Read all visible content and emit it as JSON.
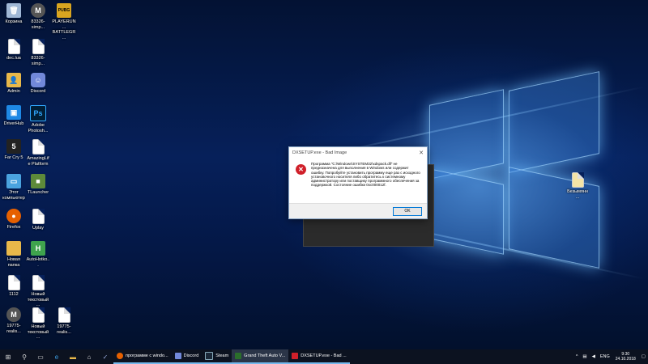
{
  "desktop": {
    "icons": [
      {
        "label": "Корзина",
        "icon": "recycle-bin-icon",
        "color": "#9fb7d6"
      },
      {
        "label": "83326-simp...",
        "icon": "app-m-icon",
        "color": "#555555"
      },
      {
        "label": "PLAYERUN... BATTLEGR...",
        "icon": "pubg-icon",
        "color": "#d9a520"
      },
      {
        "label": "dec.lua",
        "icon": "file-icon",
        "color": "#ffffff"
      },
      {
        "label": "83326-simp...",
        "icon": "file-icon",
        "color": "#ffffff"
      },
      {
        "label": "Admin",
        "icon": "user-folder-icon",
        "color": "#e8b84a"
      },
      {
        "label": "Discord",
        "icon": "discord-icon",
        "color": "#7289da"
      },
      {
        "label": "DriverHub",
        "icon": "driverhub-icon",
        "color": "#1e88e5"
      },
      {
        "label": "Adobe Photosh...",
        "icon": "photoshop-icon",
        "color": "#001e36"
      },
      {
        "label": "Far Cry 5",
        "icon": "farcry5-icon",
        "color": "#222222"
      },
      {
        "label": "AmazingLife Platform",
        "icon": "file-icon",
        "color": "#ffffff"
      },
      {
        "label": "Этот компьютер",
        "icon": "computer-icon",
        "color": "#4aa3df"
      },
      {
        "label": "TLauncher",
        "icon": "minecraft-icon",
        "color": "#5d8a3a"
      },
      {
        "label": "Firefox",
        "icon": "firefox-icon",
        "color": "#e66000"
      },
      {
        "label": "Uplay",
        "icon": "file-icon",
        "color": "#ffffff"
      },
      {
        "label": "Новая папка",
        "icon": "folder-icon",
        "color": "#e8b84a"
      },
      {
        "label": "AutoHotko...",
        "icon": "autohotkey-icon",
        "color": "#3fa34d"
      },
      {
        "label": "1112",
        "icon": "file-icon",
        "color": "#ffffff"
      },
      {
        "label": "Новый текстовый ...",
        "icon": "file-icon",
        "color": "#ffffff"
      },
      {
        "label": "19775-realis...",
        "icon": "app-m-icon",
        "color": "#555555"
      },
      {
        "label": "Новый текстовый ...",
        "icon": "file-icon",
        "color": "#ffffff"
      },
      {
        "label": "19775-realis...",
        "icon": "file-icon",
        "color": "#ffffff"
      }
    ],
    "right_file": {
      "label": "Безымянн..."
    }
  },
  "dialog": {
    "title": "DXSETUP.exe - Bad Image",
    "close": "✕",
    "message": "Программа \"C:\\Windows\\SYSTEM32\\xdspack.dll\" не предназначена для выполнения в Windows или содержит ошибку. Попробуйте установить программу еще раз с исходного установочного носителя либо обратитесь к системному администратору или поставщику программного обеспечения за поддержкой. Состояние ошибки 0xc000012f.",
    "ok": "OK"
  },
  "taskbar": {
    "start": "⊞",
    "search": "⚲",
    "apps": [
      {
        "label": "программе с windo...",
        "color": "#e66000",
        "active": false
      },
      {
        "label": "Discord",
        "color": "#7289da",
        "active": false
      },
      {
        "label": "Steam",
        "color": "#1b2838",
        "active": false
      },
      {
        "label": "Grand Theft Auto V...",
        "color": "#2b6e2b",
        "active": true
      },
      {
        "label": "DXSETUP.exe - Bad ...",
        "color": "#d0202a",
        "active": false
      }
    ],
    "tray": {
      "lang": "ENG",
      "time": "9:30",
      "date": "24.10.2018"
    }
  }
}
